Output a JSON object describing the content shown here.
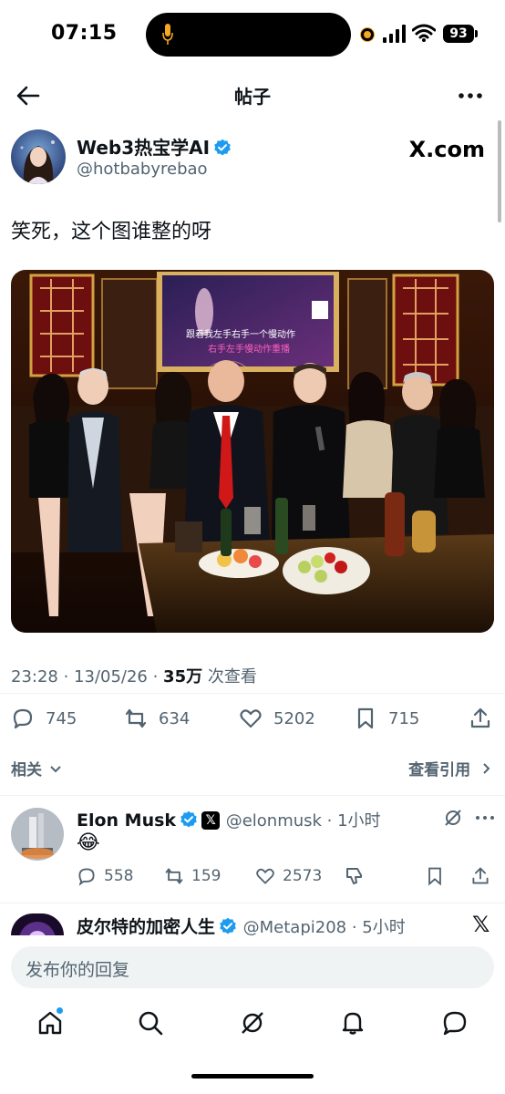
{
  "status_bar": {
    "time": "07:15",
    "battery": "93"
  },
  "header": {
    "title": "帖子"
  },
  "post": {
    "author_name": "Web3热宝学AI",
    "author_handle": "@hotbabyrebao",
    "source_logo": "X.com",
    "text": "笑死，这个图谁整的呀",
    "image_caption_lines": [
      "跟着我左手右手一个慢动作",
      "右手左手慢动作重播"
    ],
    "timestamp": "23:28 · 13/05/26 · ",
    "views_count": "35万",
    "views_label": " 次查看",
    "replies": "745",
    "retweets": "634",
    "likes": "5202",
    "bookmarks": "715"
  },
  "related": {
    "label": "相关",
    "view_quotes": "查看引用"
  },
  "replies": [
    {
      "name": "Elon Musk",
      "handle": "@elonmusk · 1小时",
      "text": "😂",
      "replies": "558",
      "retweets": "159",
      "likes": "2573"
    },
    {
      "name": "皮尔特的加密人生",
      "handle": "@Metapi208 · 5小时"
    }
  ],
  "composer": {
    "placeholder": "发布你的回复"
  },
  "colors": {
    "accent": "#1d9bf0",
    "text": "#0f1419",
    "muted": "#536471"
  },
  "icons": [
    "back-arrow-icon",
    "more-icon",
    "verified-icon",
    "reply-icon",
    "retweet-icon",
    "like-icon",
    "bookmark-icon",
    "share-icon",
    "home-icon",
    "search-icon",
    "grok-icon",
    "bell-icon",
    "messages-icon"
  ]
}
